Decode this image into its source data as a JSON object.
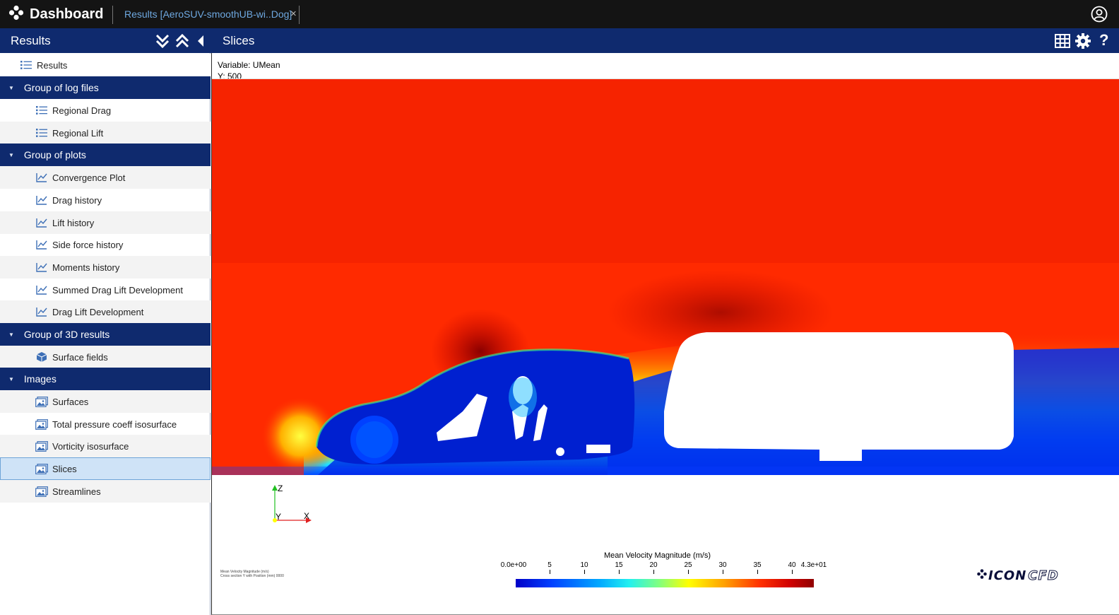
{
  "app": {
    "title": "Dashboard",
    "tab_label": "Results [AeroSUV-smoothUB-wi..Dog]",
    "tab_close": "×"
  },
  "subheader": {
    "left_title": "Results",
    "right_title": "Slices"
  },
  "sidebar": {
    "top_item": "Results",
    "groups": [
      {
        "label": "Group of log files",
        "items": [
          "Regional Drag",
          "Regional Lift"
        ]
      },
      {
        "label": "Group of plots",
        "items": [
          "Convergence Plot",
          "Drag history",
          "Lift history",
          "Side force history",
          "Moments history",
          "Summed Drag Lift Development",
          "Drag Lift Development"
        ]
      },
      {
        "label": "Group of 3D results",
        "items": [
          "Surface fields"
        ]
      },
      {
        "label": "Images",
        "items": [
          "Surfaces",
          "Total pressure coeff isosurface",
          "Vorticity isosurface",
          "Slices",
          "Streamlines"
        ]
      }
    ],
    "selected_item": "Slices"
  },
  "viewport": {
    "variable": "Variable: UMean",
    "position": "Y: 500",
    "axis_labels": {
      "z": "Z",
      "y": "Y",
      "x": "X"
    },
    "note_line1": "Mean Velocity Magnitude (m/s)",
    "note_line2": "Cross section Y with Position (mm) 0000"
  },
  "colorbar": {
    "title": "Mean Velocity Magnitude (m/s)",
    "min_label": "0.0e+00",
    "max_label": "4.3e+01",
    "ticks": [
      "5",
      "10",
      "15",
      "20",
      "25",
      "30",
      "35",
      "40"
    ]
  },
  "logo": {
    "part1": "ICON",
    "part2": "CFD"
  },
  "colors": {
    "topbar": "#141414",
    "header_blue": "#0f2a6e",
    "tab_link": "#6ea8e0",
    "selected_row": "#cfe3f7",
    "icon_blue": "#3d6fb6"
  }
}
